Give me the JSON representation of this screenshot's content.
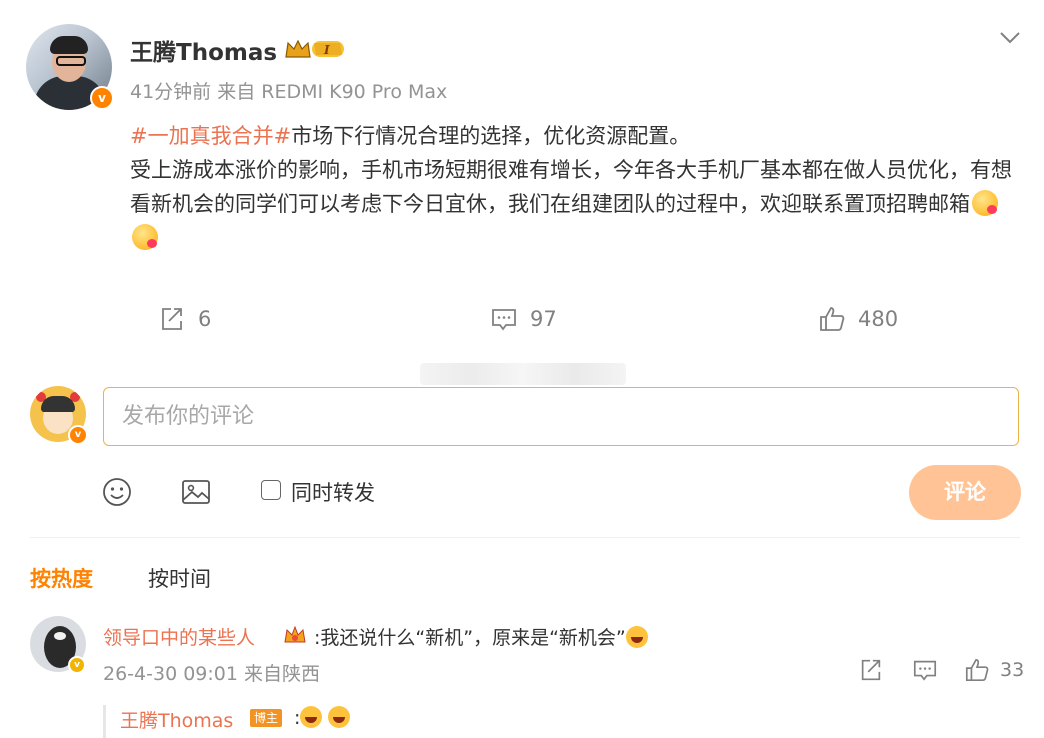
{
  "post": {
    "author": "王腾Thomas",
    "time_source": "41分钟前 来自 REDMI K90 Pro Max",
    "topic": "#一加真我合并#",
    "line1_rest": "市场下行情况合理的选择，优化资源配置。",
    "body": "受上游成本涨价的影响，手机市场短期很难有增长，今年各大手机厂基本都在做人员优化，有想看新机会的同学们可以考虑下今日宜休，我们在组建团队的过程中，欢迎联系置顶招聘邮箱",
    "repost_count": "6",
    "comment_count": "97",
    "like_count": "480"
  },
  "composer": {
    "placeholder": "发布你的评论",
    "also_repost_label": "同时转发",
    "submit_label": "评论"
  },
  "sort": {
    "hot": "按热度",
    "time": "按时间"
  },
  "comment": {
    "author": "领导口中的某些人",
    "text": ":我还说什么“新机”，原来是“新机会”",
    "time_source": "26-4-30 09:01 来自陕西",
    "like_count": "33",
    "reply": {
      "author": "王腾Thomas",
      "badge": "博主",
      "text": ":"
    }
  },
  "icons": [
    "verified-icon",
    "crown-icon",
    "chevron-down-icon",
    "repost-icon",
    "comment-icon",
    "like-icon",
    "emoji-icon",
    "image-icon"
  ],
  "colors": {
    "brand": "#ff8200",
    "link": "#eb7350",
    "submit": "#ffc395"
  }
}
